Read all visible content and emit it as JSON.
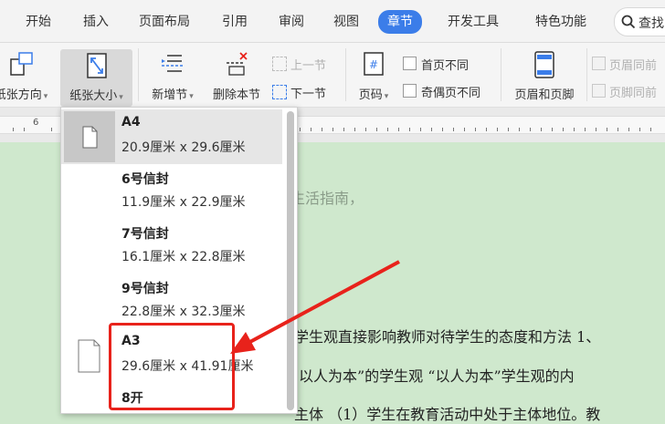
{
  "tabs": [
    {
      "label": "开始"
    },
    {
      "label": "插入"
    },
    {
      "label": "页面布局"
    },
    {
      "label": "引用"
    },
    {
      "label": "审阅"
    },
    {
      "label": "视图"
    },
    {
      "label": "章节",
      "active": true
    },
    {
      "label": "开发工具"
    },
    {
      "label": "特色功能"
    }
  ],
  "search": {
    "label": "查找"
  },
  "ribbon": {
    "paper_direction": "纸张方向",
    "paper_size": "纸张大小",
    "new_section": "新增节",
    "delete_section": "删除本节",
    "prev_section": "上一节",
    "next_section": "下一节",
    "page_number": "页码",
    "first_page_diff": "首页不同",
    "odd_even_diff": "奇偶页不同",
    "header_footer": "页眉和页脚",
    "header_same": "页眉同前",
    "footer_same": "页脚同前"
  },
  "ruler": {
    "number": "6"
  },
  "paper_sizes": [
    {
      "name": "A4",
      "width": "20.9厘米",
      "height": "29.6厘米",
      "selected": true
    },
    {
      "name": "6号信封",
      "width": "11.9厘米",
      "height": "22.9厘米"
    },
    {
      "name": "7号信封",
      "width": "16.1厘米",
      "height": "22.8厘米"
    },
    {
      "name": "9号信封",
      "width": "22.8厘米",
      "height": "32.3厘米"
    },
    {
      "name": "A3",
      "width": "29.6厘米",
      "height": "41.91厘米"
    },
    {
      "name": "8开",
      "width": "",
      "height": ""
    }
  ],
  "dim_sep": "x",
  "document": {
    "line1": "生活指南，",
    "line2": "学生观直接影响教师对待学生的态度和方法 1、",
    "line3": "以人为本”的学生观 “以人为本”学生观的内",
    "line4": "主体 （1）学生在教育活动中处于主体地位。教"
  },
  "colors": {
    "accent": "#3b7de9",
    "highlight": "#e8221b",
    "page_bg": "#cfe8cd"
  }
}
